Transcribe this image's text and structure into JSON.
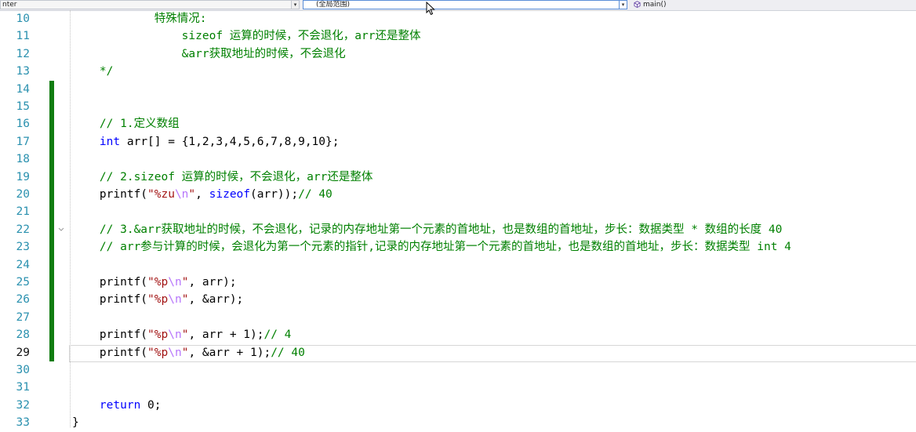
{
  "navbar": {
    "project_box": "nter",
    "scope_box": "(全局范围)",
    "member_box": "main()",
    "arrow_glyph": "▾"
  },
  "colors": {
    "keyword": "#0000ff",
    "comment": "#008000",
    "string": "#a31515",
    "escape": "#b776fb",
    "line_number": "#2b91af",
    "change_bar": "#107c10"
  },
  "editor": {
    "current_line": 29,
    "lines": [
      {
        "n": 10,
        "tokens": [
          {
            "t": "            特殊情况:",
            "c": "cm"
          }
        ]
      },
      {
        "n": 11,
        "tokens": [
          {
            "t": "                sizeof 运算的时候，不会退化，arr还是整体",
            "c": "cm"
          }
        ]
      },
      {
        "n": 12,
        "tokens": [
          {
            "t": "                &arr获取地址的时候，不会退化",
            "c": "cm"
          }
        ]
      },
      {
        "n": 13,
        "tokens": [
          {
            "t": "    */",
            "c": "cm"
          }
        ]
      },
      {
        "n": 14,
        "tokens": []
      },
      {
        "n": 15,
        "tokens": []
      },
      {
        "n": 16,
        "tokens": [
          {
            "t": "    // 1.定义数组",
            "c": "cm"
          }
        ]
      },
      {
        "n": 17,
        "tokens": [
          {
            "t": "    ",
            "c": ""
          },
          {
            "t": "int",
            "c": "kw"
          },
          {
            "t": " arr[] = {1,2,3,4,5,6,7,8,9,10};",
            "c": ""
          }
        ]
      },
      {
        "n": 18,
        "tokens": []
      },
      {
        "n": 19,
        "tokens": [
          {
            "t": "    // 2.sizeof 运算的时候，不会退化，arr还是整体",
            "c": "cm"
          }
        ]
      },
      {
        "n": 20,
        "tokens": [
          {
            "t": "    printf(",
            "c": ""
          },
          {
            "t": "\"%zu",
            "c": "st"
          },
          {
            "t": "\\n",
            "c": "esc"
          },
          {
            "t": "\"",
            "c": "st"
          },
          {
            "t": ", ",
            "c": ""
          },
          {
            "t": "sizeof",
            "c": "kw"
          },
          {
            "t": "(arr));",
            "c": ""
          },
          {
            "t": "// 40",
            "c": "cm"
          }
        ]
      },
      {
        "n": 21,
        "tokens": []
      },
      {
        "n": 22,
        "tokens": [
          {
            "t": "    // 3.&arr获取地址的时候，不会退化，记录的内存地址第一个元素的首地址，也是数组的首地址，步长：数据类型 * 数组的长度 40",
            "c": "cm"
          }
        ]
      },
      {
        "n": 23,
        "tokens": [
          {
            "t": "    // arr参与计算的时候，会退化为第一个元素的指针,记录的内存地址第一个元素的首地址，也是数组的首地址，步长：数据类型 int 4",
            "c": "cm"
          }
        ]
      },
      {
        "n": 24,
        "tokens": []
      },
      {
        "n": 25,
        "tokens": [
          {
            "t": "    printf(",
            "c": ""
          },
          {
            "t": "\"%p",
            "c": "st"
          },
          {
            "t": "\\n",
            "c": "esc"
          },
          {
            "t": "\"",
            "c": "st"
          },
          {
            "t": ", arr);",
            "c": ""
          }
        ]
      },
      {
        "n": 26,
        "tokens": [
          {
            "t": "    printf(",
            "c": ""
          },
          {
            "t": "\"%p",
            "c": "st"
          },
          {
            "t": "\\n",
            "c": "esc"
          },
          {
            "t": "\"",
            "c": "st"
          },
          {
            "t": ", &arr);",
            "c": ""
          }
        ]
      },
      {
        "n": 27,
        "tokens": []
      },
      {
        "n": 28,
        "tokens": [
          {
            "t": "    printf(",
            "c": ""
          },
          {
            "t": "\"%p",
            "c": "st"
          },
          {
            "t": "\\n",
            "c": "esc"
          },
          {
            "t": "\"",
            "c": "st"
          },
          {
            "t": ", arr + 1);",
            "c": ""
          },
          {
            "t": "// 4",
            "c": "cm"
          }
        ]
      },
      {
        "n": 29,
        "tokens": [
          {
            "t": "    printf(",
            "c": ""
          },
          {
            "t": "\"%p",
            "c": "st"
          },
          {
            "t": "\\n",
            "c": "esc"
          },
          {
            "t": "\"",
            "c": "st"
          },
          {
            "t": ", &arr + 1);",
            "c": ""
          },
          {
            "t": "// 40",
            "c": "cm"
          }
        ]
      },
      {
        "n": 30,
        "tokens": []
      },
      {
        "n": 31,
        "tokens": []
      },
      {
        "n": 32,
        "tokens": [
          {
            "t": "    ",
            "c": ""
          },
          {
            "t": "return",
            "c": "kw"
          },
          {
            "t": " 0;",
            "c": ""
          }
        ]
      },
      {
        "n": 33,
        "tokens": [
          {
            "t": "}",
            "c": ""
          }
        ]
      }
    ]
  }
}
